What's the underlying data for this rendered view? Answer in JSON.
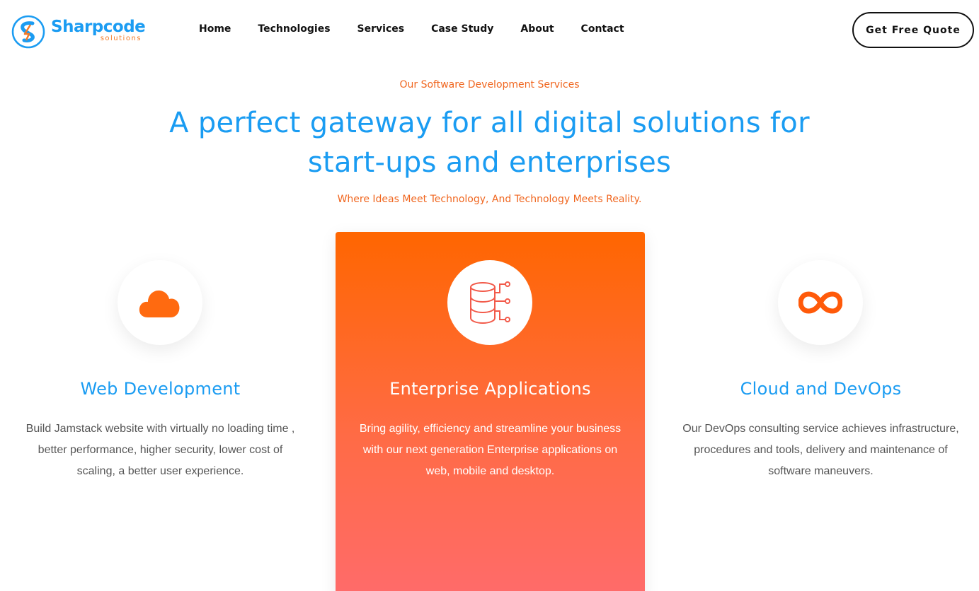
{
  "brand": {
    "name": "Sharpcode",
    "sub": "solutions",
    "primary_color": "#1b9cf2",
    "accent_color": "#f47a25"
  },
  "nav": {
    "items": [
      {
        "label": "Home"
      },
      {
        "label": "Technologies"
      },
      {
        "label": "Services"
      },
      {
        "label": "Case Study"
      },
      {
        "label": "About"
      },
      {
        "label": "Contact"
      }
    ],
    "cta_label": "Get Free Quote"
  },
  "hero": {
    "eyebrow": "Our Software Development Services",
    "headline_line1": "A perfect gateway for all digital solutions for",
    "headline_line2": "start-ups and enterprises",
    "tagline": "Where Ideas Meet Technology, And Technology Meets Reality."
  },
  "services": [
    {
      "icon": "cloud-icon",
      "title": "Web Development",
      "description": "Build Jamstack website with virtually no loading time , better performance, higher security, lower cost of scaling, a better user experience."
    },
    {
      "icon": "database-network-icon",
      "title": "Enterprise Applications",
      "description": "Bring agility, efficiency and streamline your business with our next generation Enterprise applications on web, mobile and desktop."
    },
    {
      "icon": "infinity-icon",
      "title": "Cloud and DevOps",
      "description": "Our DevOps consulting service achieves infrastructure, procedures and tools, delivery and maintenance of software maneuvers."
    }
  ]
}
